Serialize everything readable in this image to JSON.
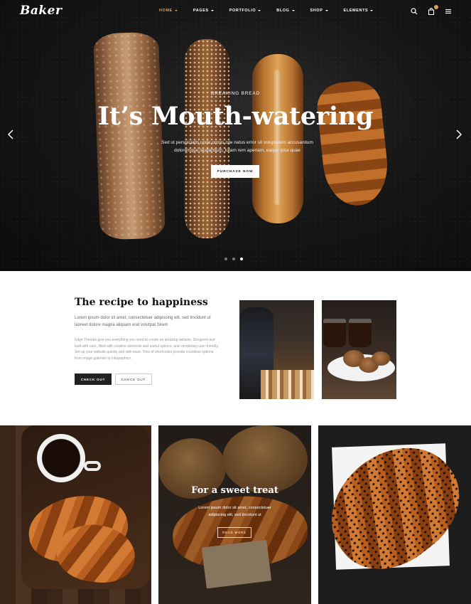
{
  "brand": {
    "logo": "Baker"
  },
  "nav": {
    "items": [
      {
        "label": "HOME",
        "active": true
      },
      {
        "label": "PAGES"
      },
      {
        "label": "PORTFOLIO"
      },
      {
        "label": "BLOG"
      },
      {
        "label": "SHOP"
      },
      {
        "label": "ELEMENTS"
      }
    ],
    "icons": [
      "search-icon",
      "cart-icon",
      "menu-icon"
    ],
    "accent": "#d8a05a"
  },
  "hero": {
    "eyebrow": "BREAKING BREAD",
    "headline": "It’s Mouth-watering",
    "sub": "Sed ut perspiciatis unde omnis iste natus error sit voluptatem accusantium doloremque laudantium, totam rem aperiam, eaque ipsa quae",
    "button": "PURCHASE NOW",
    "slides": 3,
    "active_slide": 3
  },
  "about": {
    "title": "The recipe to happiness",
    "lead": "Lorem ipsum dolor sit amet, consectetuer adipiscing elit, sed tincidunt ut laoreet dolore magna aliquam erat volutpat.Sirem",
    "body": "Edge Themes give you everything you need to create an amazing website. Designed and built with care, filled with creative elements and useful options, and completely user-friendly. Set up your website quickly and with ease. Tons of shortcodes provide countless options, from image galleries to infographics.",
    "btn_primary": "CHECK OUT",
    "btn_secondary": "CHECK OUT"
  },
  "gallery": {
    "center_title": "For a sweet treat",
    "center_text": "Lorem ipsum dolor sit amet, consectetuer adipiscing elit, sed tincidunt ut",
    "center_btn": "READ MORE"
  }
}
